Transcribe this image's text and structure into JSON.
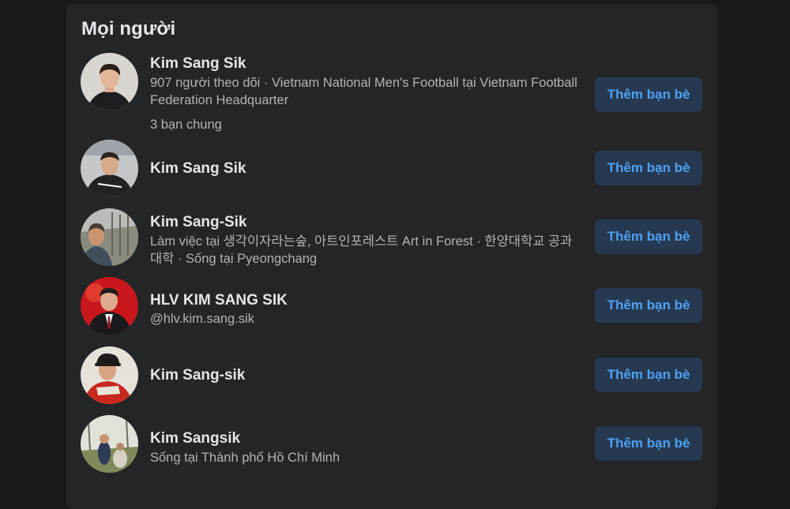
{
  "section": {
    "title": "Mọi người"
  },
  "add_friend_label": "Thêm bạn bè",
  "people": [
    {
      "name": "Kim Sang Sik",
      "detail": "907 người theo dõi · Vietnam National Men's Football tại Vietnam Football Federation Headquarter",
      "mutual": "3 bạn chung"
    },
    {
      "name": "Kim Sang Sik"
    },
    {
      "name": "Kim Sang-Sik",
      "detail": "Làm việc tại 생각이자라는숲, 아트인포레스트 Art in Forest · 한양대학교 공과대학 · Sống tại Pyeongchang"
    },
    {
      "name": "HLV KIM SANG SIK",
      "detail": "@hlv.kim.sang.sik"
    },
    {
      "name": "Kim Sang-sik"
    },
    {
      "name": "Kim Sangsik",
      "detail": "Sống tại Thành phố Hồ Chí Minh"
    }
  ]
}
